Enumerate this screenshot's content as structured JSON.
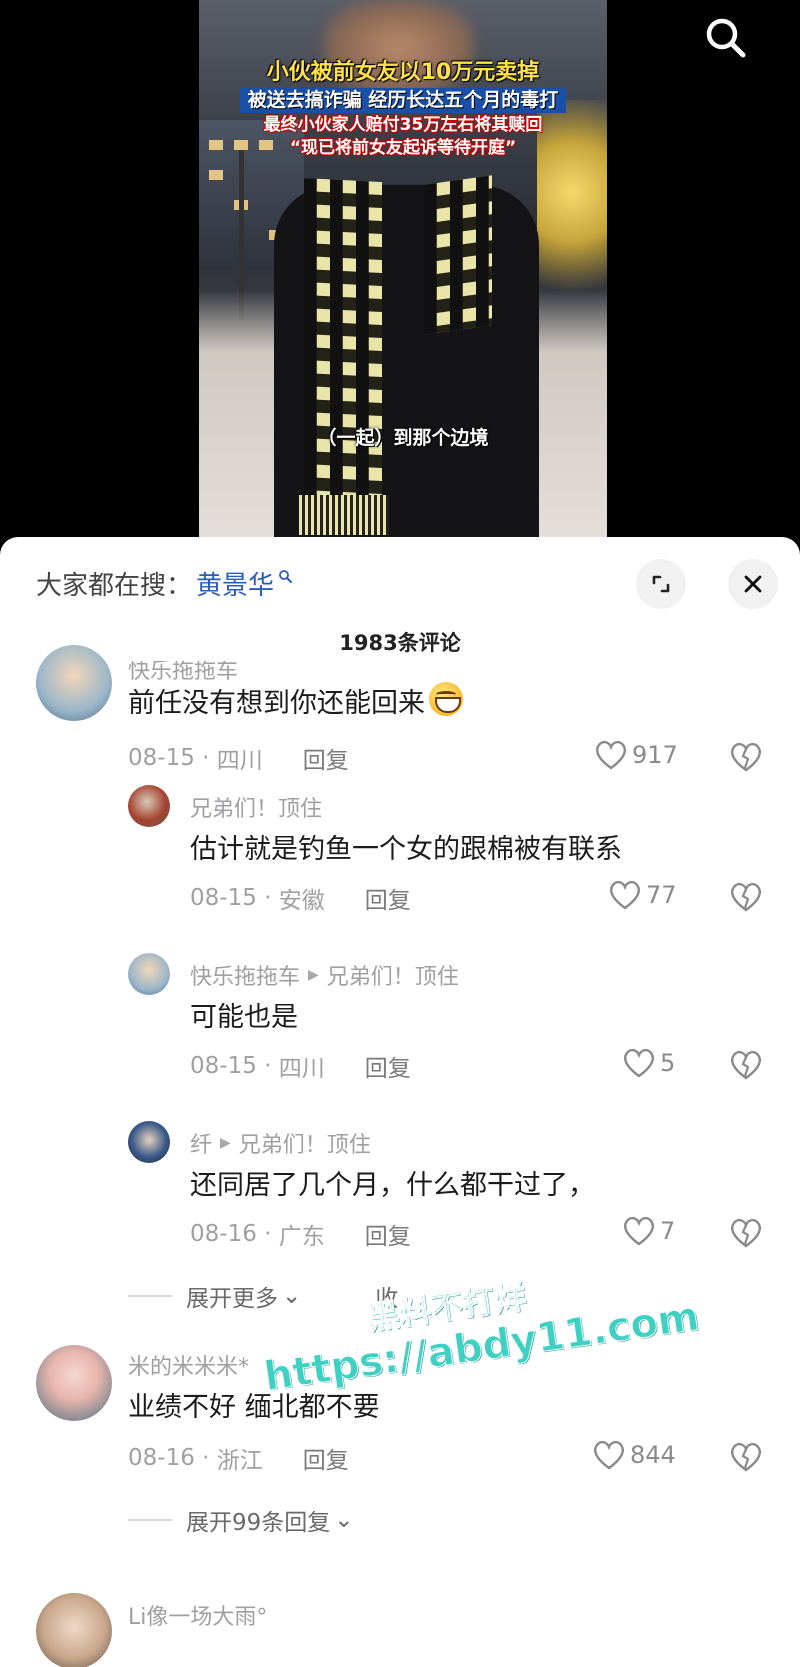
{
  "video": {
    "headline": [
      "小伙被前女友以10万元卖掉",
      "被送去搞诈骗 经历长达五个月的毒打",
      "最终小伙家人赔付35万左右将其赎回",
      "“现已将前女友起诉等待开庭”"
    ],
    "subtitle": "（一起）到那个边境",
    "search_icon": "search-icon"
  },
  "sheet": {
    "search_prefix": "大家都在搜：",
    "search_term": "黄景华",
    "comment_count": "1983条评论",
    "expand_icon": "expand-icon",
    "close_icon": "close-icon"
  },
  "comments": [
    {
      "user": "快乐拖拖车",
      "text": "前任没有想到你还能回来",
      "emoji": "grin-emoji",
      "date": "08-15",
      "location": "四川",
      "reply": "回复",
      "likes": "917"
    },
    {
      "user": "兄弟们！顶住",
      "text": "估计就是钓鱼一个女的跟棉被有联系",
      "date": "08-15",
      "location": "安徽",
      "reply": "回复",
      "likes": "77"
    },
    {
      "user": "快乐拖拖车",
      "reply_to": "兄弟们！顶住",
      "text": "可能也是",
      "date": "08-15",
      "location": "四川",
      "reply": "回复",
      "likes": "5"
    },
    {
      "user": "纤",
      "reply_to": "兄弟们！顶住",
      "text": "还同居了几个月，什么都干过了，",
      "date": "08-16",
      "location": "广东",
      "reply": "回复",
      "likes": "7"
    },
    {
      "user": "米的米米米*",
      "text": "业绩不好 缅北都不要",
      "date": "08-16",
      "location": "浙江",
      "reply": "回复",
      "likes": "844"
    },
    {
      "user": "Li像一场大雨°"
    }
  ],
  "expand_more": "展开更多",
  "expand_replies": "展开99条回复",
  "collapse_partial": "收",
  "watermark": {
    "line1": "黑料不打烊",
    "line2": "https://abdy11.com"
  },
  "colors": {
    "search_term": "#2c5bb8",
    "meta_gray": "#a0a0a4",
    "watermark": "#3fd0c4"
  }
}
